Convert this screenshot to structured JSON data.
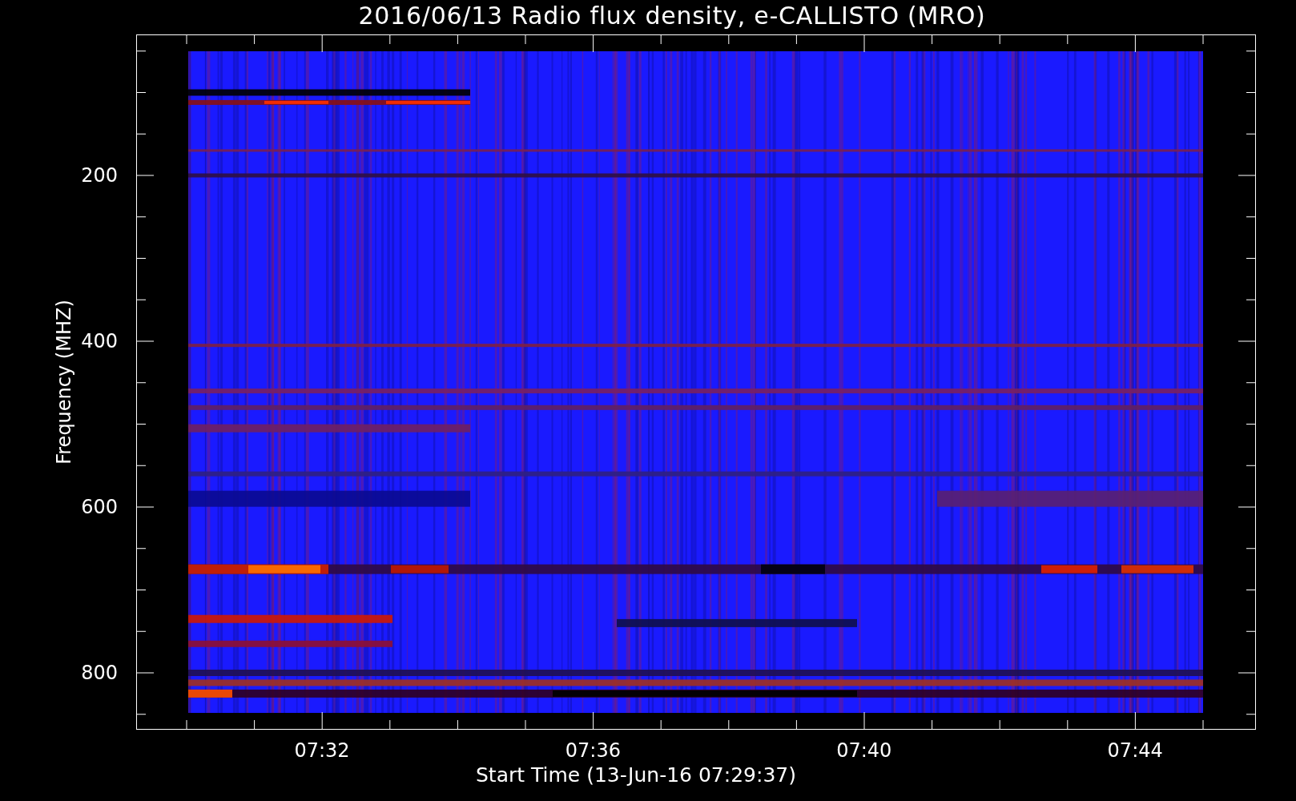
{
  "title": "2016/06/13  Radio flux density, e-CALLISTO (MRO)",
  "y_axis": {
    "label": "Frequency (MHZ)",
    "tick_labels": [
      "200",
      "400",
      "600",
      "800"
    ]
  },
  "x_axis": {
    "label": "Start Time (13-Jun-16 07:29:37)",
    "tick_labels": [
      "07:32",
      "07:36",
      "07:40",
      "07:44"
    ]
  }
}
